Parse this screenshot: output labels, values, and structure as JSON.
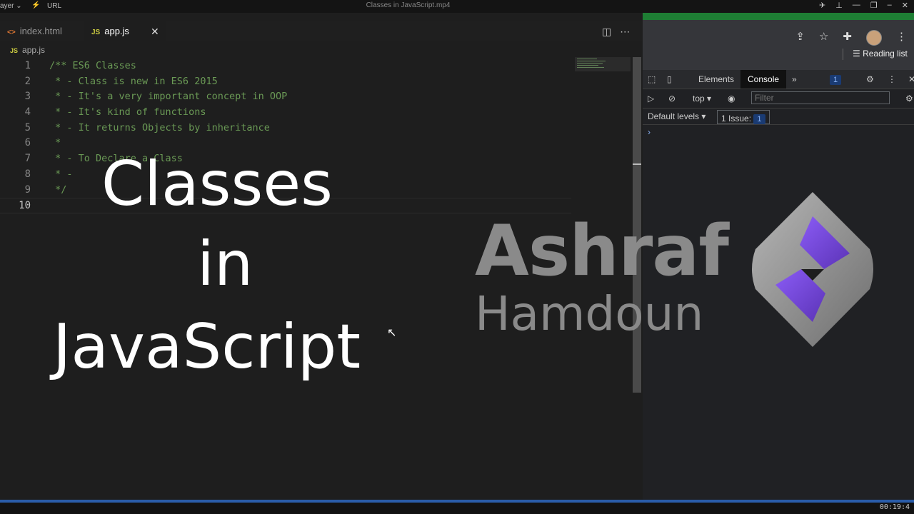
{
  "player": {
    "menu_label": "ayer ⌄",
    "url_label": "URL",
    "title": "Classes in JavaScript.mp4",
    "time": "00:19:4"
  },
  "editor": {
    "tabs": [
      {
        "icon": "<>",
        "label": "index.html"
      },
      {
        "icon": "JS",
        "label": "app.js"
      }
    ],
    "close_glyph": "✕",
    "breadcrumb": {
      "icon": "JS",
      "label": "app.js"
    },
    "lines": [
      {
        "n": "1",
        "text": "/** ES6 Classes"
      },
      {
        "n": "2",
        "text": " * - Class is new in ES6 2015"
      },
      {
        "n": "3",
        "text": " * - It's a very important concept in OOP"
      },
      {
        "n": "4",
        "text": " * - It's kind of functions"
      },
      {
        "n": "5",
        "text": " * - It returns Objects by inheritance"
      },
      {
        "n": "6",
        "text": " *"
      },
      {
        "n": "7",
        "text": " * - To Declare a Class"
      },
      {
        "n": "8",
        "text": " * -"
      },
      {
        "n": "9",
        "text": " */"
      },
      {
        "n": "10",
        "text": ""
      }
    ]
  },
  "overlay": {
    "line1": "Classes",
    "line2": "in",
    "line3": "JavaScript"
  },
  "brand": {
    "name1": "Ashraf",
    "name2": "Hamdoun"
  },
  "devtools": {
    "reading_list": "Reading list",
    "tabs": {
      "elements": "Elements",
      "console": "Console",
      "more": "»",
      "badge": "1"
    },
    "context": "top ▾",
    "filter_placeholder": "Filter",
    "levels": "Default levels ▾",
    "issues_label": "1 Issue:",
    "issues_count": "1",
    "prompt": "›"
  },
  "colors": {
    "comment": "#6a9955",
    "accent": "#2a5ca8",
    "logo_purple": "#7a4fd6"
  }
}
